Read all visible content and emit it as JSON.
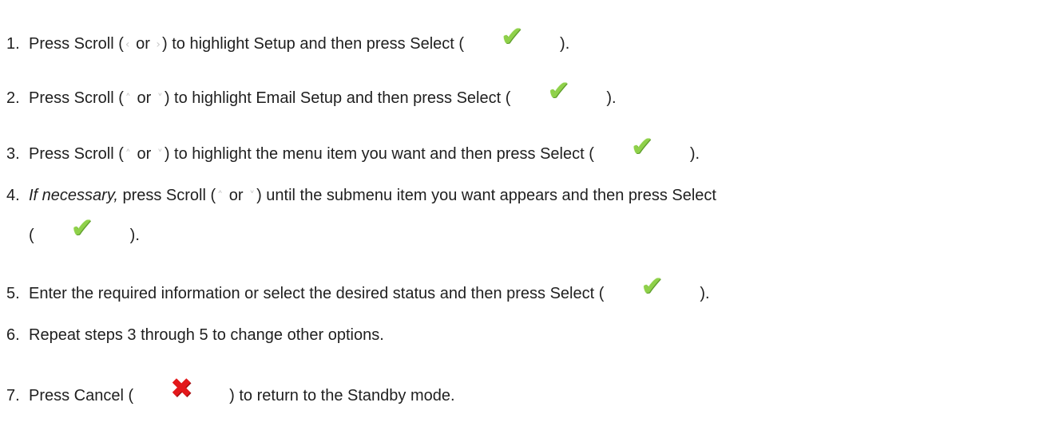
{
  "steps": [
    {
      "num": "1.",
      "text_a": "Press Scroll (",
      "arrow_left": "<",
      "or": "or",
      "arrow_right": ">",
      "text_b": ") to highlight Setup and then press Select (",
      "text_c": ")."
    },
    {
      "num": "2.",
      "text_a": "Press Scroll (",
      "arrow_up": "^",
      "or": "or",
      "arrow_down": "v",
      "text_b": ") to highlight Email Setup and then press Select (",
      "text_c": ")."
    },
    {
      "num": "3.",
      "text_a": "Press Scroll (",
      "arrow_up": "^",
      "or": "or",
      "arrow_down": "v",
      "text_b": ") to highlight the menu item you want and then press Select (",
      "text_c": ")."
    },
    {
      "num": "4.",
      "italic": "If necessary,",
      "text_a": "press Scroll (",
      "arrow_up": "^",
      "or": "or",
      "arrow_down": "v",
      "text_b": ") until the submenu item you want appears and then press Select",
      "cont_open": "(",
      "text_c": ")."
    },
    {
      "num": "5.",
      "text_a": "Enter the required information or select the desired status and then press Select (",
      "text_c": ")."
    },
    {
      "num": "6.",
      "text_a": "Repeat steps 3 through 5 to change other options."
    },
    {
      "num": "7.",
      "text_a": "Press Cancel (",
      "text_c": ") to return to the Standby mode."
    }
  ],
  "icons": {
    "select": "checkmark-icon",
    "cancel": "x-icon",
    "scroll_left": "left-arrow-icon",
    "scroll_right": "right-arrow-icon",
    "scroll_up": "up-arrow-icon",
    "scroll_down": "down-arrow-icon"
  },
  "colors": {
    "check": "#8fd14a",
    "cross": "#e3181b",
    "arrow": "#c9c9c9",
    "text": "#1f1f1f"
  }
}
